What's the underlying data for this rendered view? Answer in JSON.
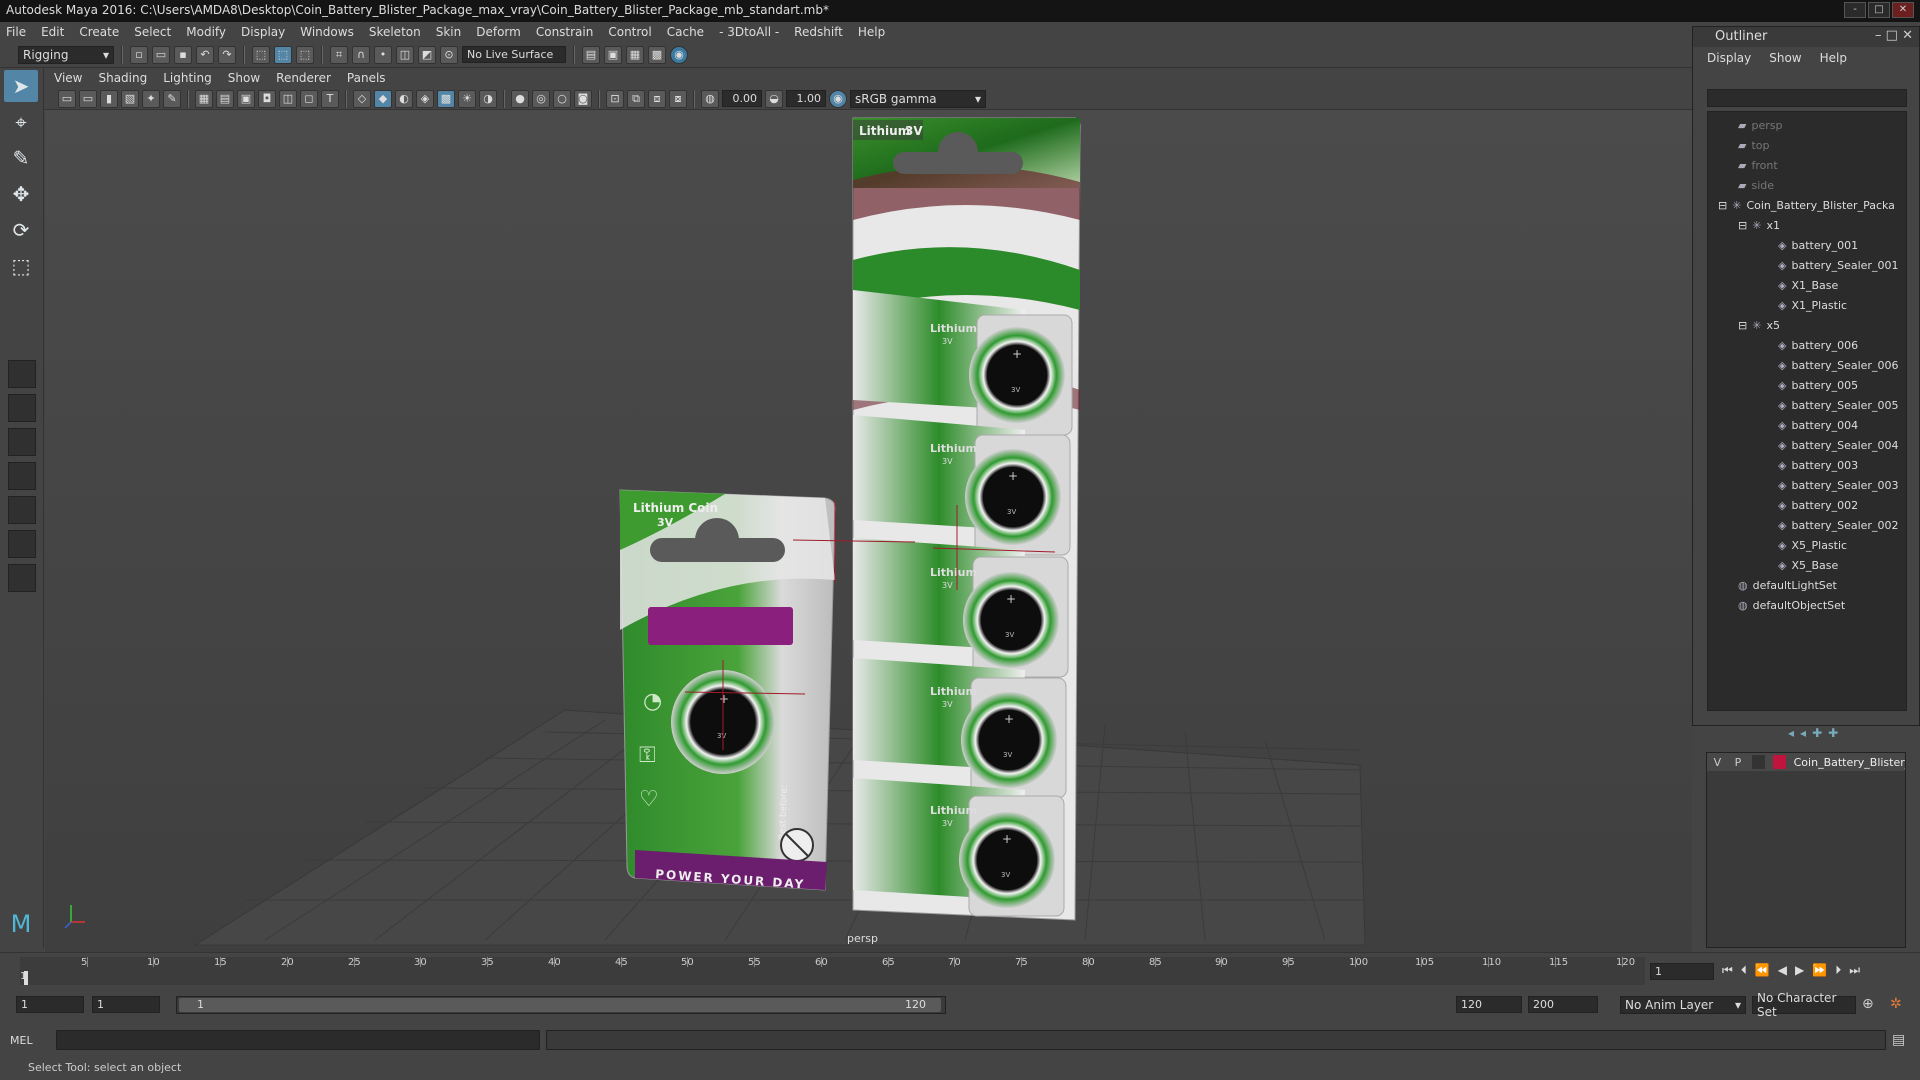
{
  "window": {
    "title": "Autodesk Maya 2016: C:\\Users\\AMDA8\\Desktop\\Coin_Battery_Blister_Package_max_vray\\Coin_Battery_Blister_Package_mb_standart.mb*",
    "controls": [
      "-",
      "□",
      "✕"
    ]
  },
  "menubar": [
    "File",
    "Edit",
    "Create",
    "Select",
    "Modify",
    "Display",
    "Windows",
    "Skeleton",
    "Skin",
    "Deform",
    "Constrain",
    "Control",
    "Cache",
    "- 3DtoAll -",
    "Redshift",
    "Help"
  ],
  "shelf": {
    "mode": "Rigging",
    "live_surface": "No Live Surface"
  },
  "viewport": {
    "menu": [
      "View",
      "Shading",
      "Lighting",
      "Show",
      "Renderer",
      "Panels"
    ],
    "exposure": "0.00",
    "gamma": "1.00",
    "color_space": "sRGB gamma",
    "camera_label": "persp",
    "single_pack": {
      "brand_line1": "Lithium Coin",
      "brand_line2": "3V",
      "slogan": "POWER YOUR DAY",
      "side_text": "Best before:",
      "cell_label": "3V"
    },
    "multi_pack": {
      "header_brand": "Lithium",
      "header_volt": "3V",
      "card_label": "Lithium",
      "card_volt": "3V",
      "cell_label": "3V"
    }
  },
  "outliner": {
    "title": "Outliner",
    "menu": [
      "Display",
      "Show",
      "Help"
    ],
    "items": [
      {
        "label": "persp",
        "type": "camera",
        "depth": 0,
        "dim": true
      },
      {
        "label": "top",
        "type": "camera",
        "depth": 0,
        "dim": true
      },
      {
        "label": "front",
        "type": "camera",
        "depth": 0,
        "dim": true
      },
      {
        "label": "side",
        "type": "camera",
        "depth": 0,
        "dim": true
      },
      {
        "label": "Coin_Battery_Blister_Packa",
        "type": "group",
        "depth": 0,
        "expanded": true
      },
      {
        "label": "x1",
        "type": "group",
        "depth": 1,
        "expanded": true
      },
      {
        "label": "battery_001",
        "type": "mesh",
        "depth": 2
      },
      {
        "label": "battery_Sealer_001",
        "type": "mesh",
        "depth": 2
      },
      {
        "label": "X1_Base",
        "type": "mesh",
        "depth": 2
      },
      {
        "label": "X1_Plastic",
        "type": "mesh",
        "depth": 2
      },
      {
        "label": "x5",
        "type": "group",
        "depth": 1,
        "expanded": true
      },
      {
        "label": "battery_006",
        "type": "mesh",
        "depth": 2
      },
      {
        "label": "battery_Sealer_006",
        "type": "mesh",
        "depth": 2
      },
      {
        "label": "battery_005",
        "type": "mesh",
        "depth": 2
      },
      {
        "label": "battery_Sealer_005",
        "type": "mesh",
        "depth": 2
      },
      {
        "label": "battery_004",
        "type": "mesh",
        "depth": 2
      },
      {
        "label": "battery_Sealer_004",
        "type": "mesh",
        "depth": 2
      },
      {
        "label": "battery_003",
        "type": "mesh",
        "depth": 2
      },
      {
        "label": "battery_Sealer_003",
        "type": "mesh",
        "depth": 2
      },
      {
        "label": "battery_002",
        "type": "mesh",
        "depth": 2
      },
      {
        "label": "battery_Sealer_002",
        "type": "mesh",
        "depth": 2
      },
      {
        "label": "X5_Plastic",
        "type": "mesh",
        "depth": 2
      },
      {
        "label": "X5_Base",
        "type": "mesh",
        "depth": 2
      },
      {
        "label": "defaultLightSet",
        "type": "set",
        "depth": 0
      },
      {
        "label": "defaultObjectSet",
        "type": "set",
        "depth": 0
      }
    ]
  },
  "layers": {
    "v": "V",
    "p": "P",
    "layer_name": "Coin_Battery_Blister_P",
    "layer_color": "#c0143c"
  },
  "timeline": {
    "ticks": [
      "5",
      "10",
      "15",
      "20",
      "25",
      "30",
      "35",
      "40",
      "45",
      "50",
      "55",
      "60",
      "65",
      "70",
      "75",
      "80",
      "85",
      "90",
      "95",
      "100",
      "105",
      "110",
      "115",
      "120"
    ],
    "current_frame": "1",
    "range_start": "1",
    "playback_start": "1",
    "slider_start": "1",
    "slider_end": "120",
    "playback_end": "120",
    "range_end": "200",
    "anim_layer": "No Anim Layer",
    "character_set": "No Character Set"
  },
  "cmdline": {
    "lang": "MEL"
  },
  "help": "Select Tool: select an object"
}
